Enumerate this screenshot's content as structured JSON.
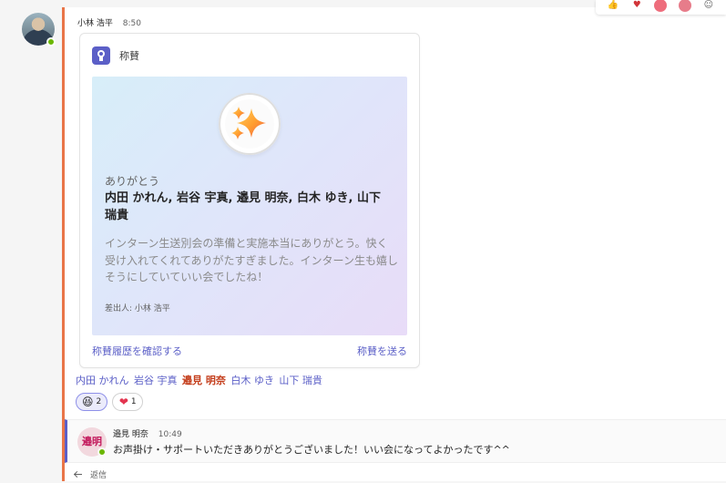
{
  "message": {
    "author": "小林 浩平",
    "time": "8:50"
  },
  "top_tray": {
    "icons": [
      "like-icon",
      "heart-icon",
      "laugh-icon",
      "surprised-icon",
      "more-icon"
    ]
  },
  "card": {
    "title": "称賛",
    "thanks_label": "ありがとう",
    "recipients": "内田 かれん, 岩谷 宇真, 邉見 明奈, 白木 ゆき, 山下 瑞貴",
    "message": "インターン生送別会の準備と実施本当にありがとう。快く受け入れてくれてありがたすぎました。インターン生も嬉しそうにしていていい会でしたね！",
    "sender": "差出人: 小林 浩平",
    "history_link": "称賛履歴を確認する",
    "send_link": "称賛を送る"
  },
  "mentions": [
    {
      "name": "内田 かれん",
      "highlight": false
    },
    {
      "name": "岩谷 宇真",
      "highlight": false
    },
    {
      "name": "邉見 明奈",
      "highlight": true
    },
    {
      "name": "白木 ゆき",
      "highlight": false
    },
    {
      "name": "山下 瑞貴",
      "highlight": false
    }
  ],
  "reactions": [
    {
      "emoji": "😆",
      "count": "2",
      "selected": true
    },
    {
      "emoji": "❤",
      "count": "1",
      "selected": false
    }
  ],
  "reply": {
    "avatar_text": "邉明",
    "author": "邉見 明奈",
    "time": "10:49",
    "text": "お声掛け・サポートいただきありがとうございました！いい会になってよかったです^^",
    "action_label": "返信"
  }
}
